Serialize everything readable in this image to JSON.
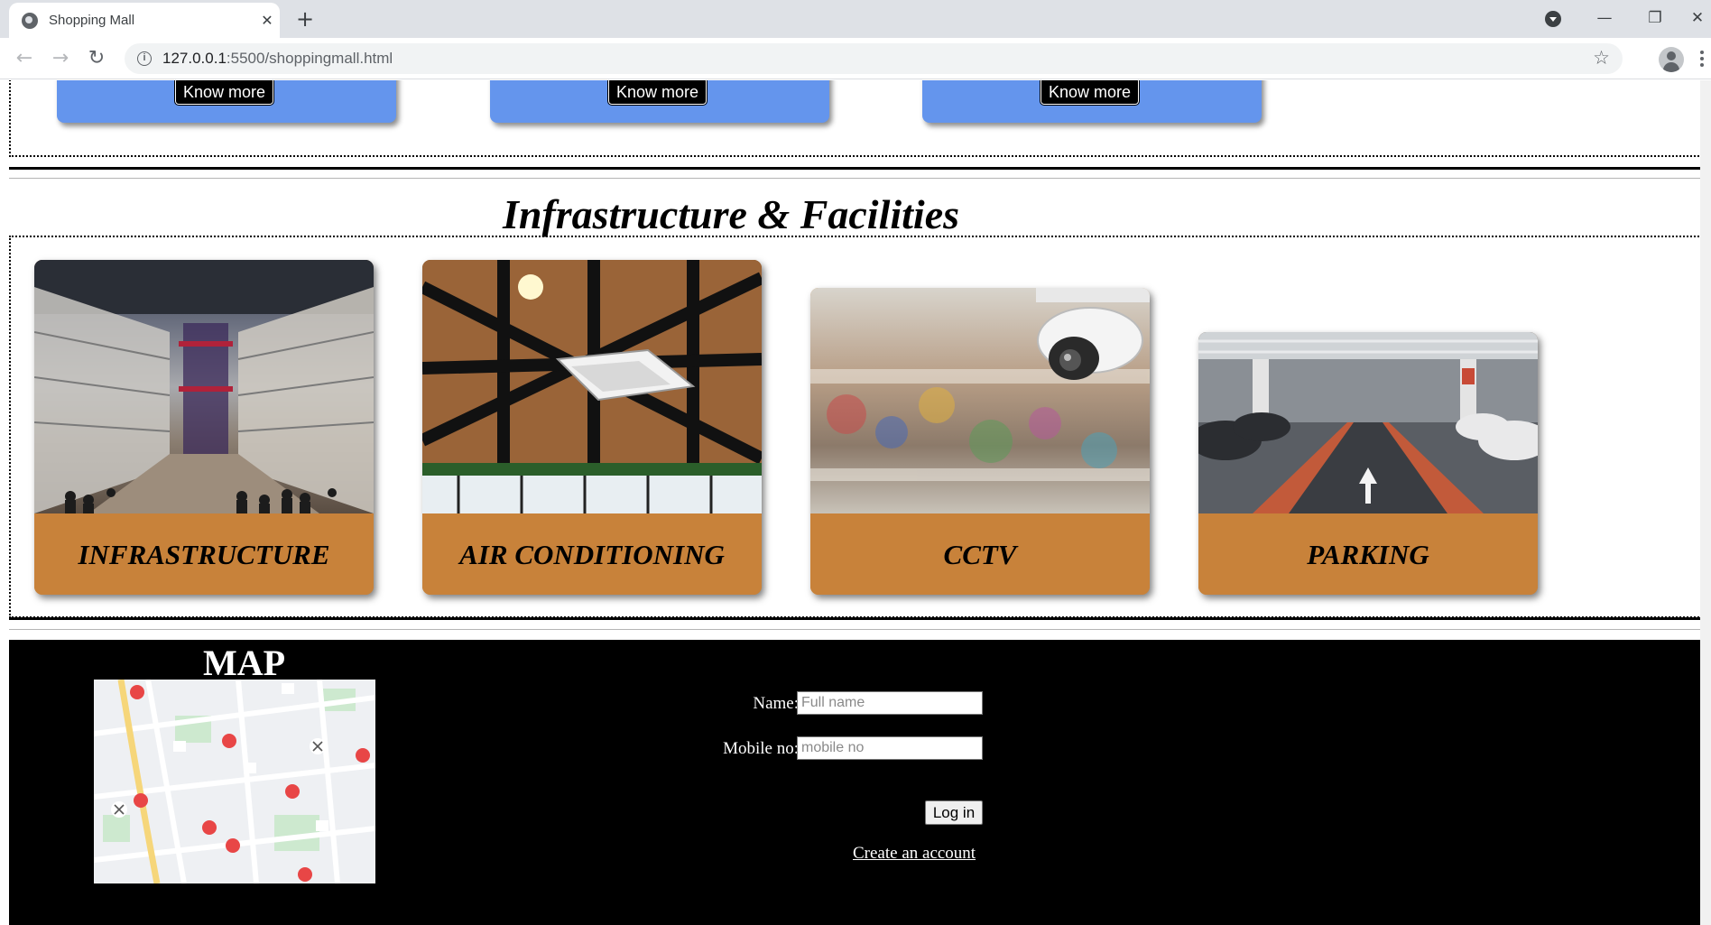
{
  "browser": {
    "tab_title": "Shopping Mall",
    "url_host": "127.0.0.1",
    "url_rest": ":5500/shoppingmall.html"
  },
  "top_cards": {
    "button_label": "Know more"
  },
  "facilities": {
    "title": "Infrastructure & Facilities",
    "cards": [
      {
        "label": "INFRASTRUCTURE"
      },
      {
        "label": "AIR CONDITIONING"
      },
      {
        "label": "CCTV"
      },
      {
        "label": "PARKING"
      }
    ]
  },
  "footer": {
    "map_title": "MAP",
    "name_label": "Name:",
    "name_placeholder": "Full name",
    "mobile_label": "Mobile no:",
    "mobile_placeholder": "mobile no",
    "login_label": "Log in",
    "create_account": "Create an account"
  },
  "colors": {
    "card_blue": "#6495ed",
    "card_brown": "#c8823a",
    "footer_bg": "#000000"
  }
}
